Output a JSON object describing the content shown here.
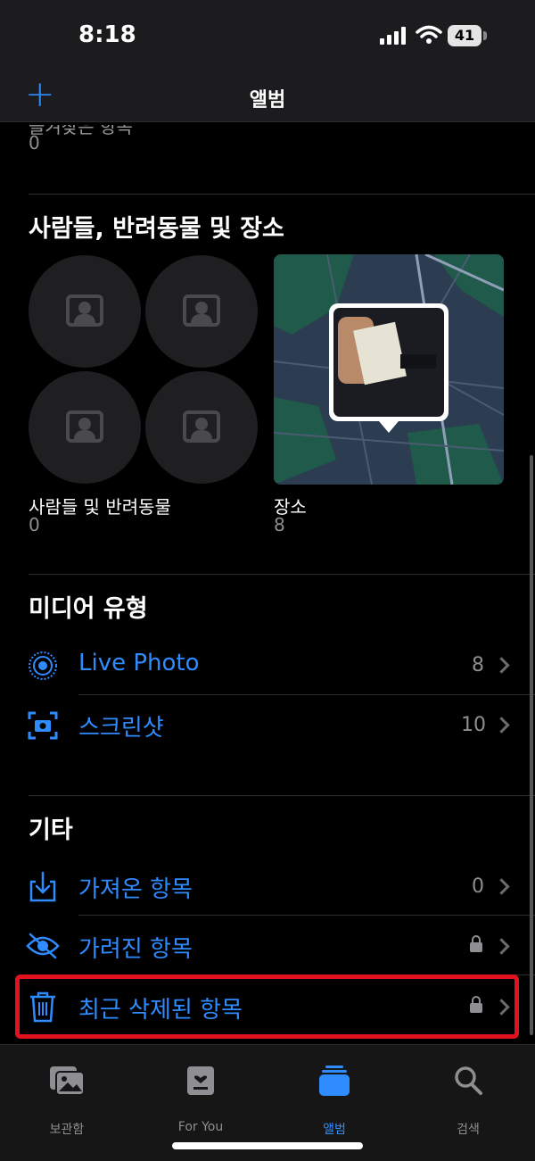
{
  "status_bar": {
    "time": "8:18",
    "battery": "41"
  },
  "nav": {
    "title": "앨범"
  },
  "peek": {
    "title": "즐겨찾은 항목",
    "count": "0"
  },
  "people_places": {
    "section_title": "사람들, 반려동물 및 장소",
    "people": {
      "label": "사람들 및 반려동물",
      "count": "0"
    },
    "places": {
      "label": "장소",
      "count": "8"
    }
  },
  "media_types": {
    "section_title": "미디어 유형",
    "items": [
      {
        "label": "Live Photo",
        "count": "8",
        "icon": "live-photo-icon"
      },
      {
        "label": "스크린샷",
        "count": "10",
        "icon": "screenshot-icon"
      }
    ]
  },
  "other": {
    "section_title": "기타",
    "items": [
      {
        "label": "가져온 항목",
        "count": "0",
        "icon": "import-icon"
      },
      {
        "label": "가려진 항목",
        "locked": true,
        "icon": "hidden-eye-icon"
      },
      {
        "label": "최근 삭제된 항목",
        "locked": true,
        "icon": "trash-icon"
      }
    ]
  },
  "tabs": [
    {
      "label": "보관함",
      "icon": "library-icon"
    },
    {
      "label": "For You",
      "icon": "for-you-icon"
    },
    {
      "label": "앨범",
      "icon": "albums-icon",
      "active": true
    },
    {
      "label": "검색",
      "icon": "search-icon"
    }
  ],
  "colors": {
    "accent": "#2f8cff",
    "highlight": "#e0121e",
    "background": "#000000"
  }
}
